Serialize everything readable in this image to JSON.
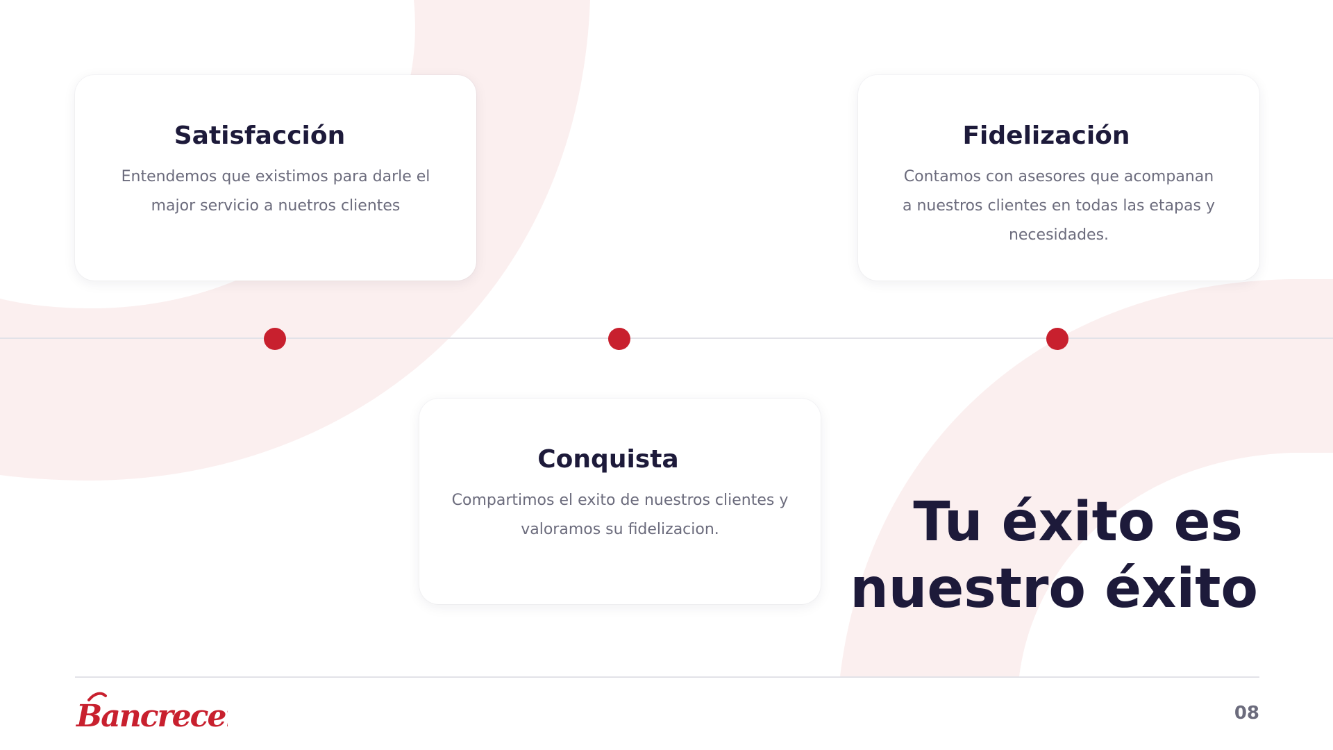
{
  "colors": {
    "accent": "#c8202e",
    "title": "#1d1a3a",
    "body_text": "#6b6b7c",
    "background_shape": "#fbefef",
    "line": "#e2e2e8"
  },
  "cards": {
    "satisfaccion": {
      "title": "Satisfacción",
      "text": "Entendemos que existimos para darle el major servicio a nuetros clientes"
    },
    "fidelizacion": {
      "title": "Fidelización",
      "text": "Contamos con asesores que acompanan a nuestros clientes en todas las etapas y necesidades."
    },
    "conquista": {
      "title": "Conquista",
      "text": "Compartimos el exito de nuestros clientes y valoramos su fidelizacion."
    }
  },
  "headline": {
    "line1": "Tu éxito es",
    "line2": "nuestro éxito"
  },
  "footer": {
    "logo_text": "Bancrecer",
    "page_number": "08"
  }
}
